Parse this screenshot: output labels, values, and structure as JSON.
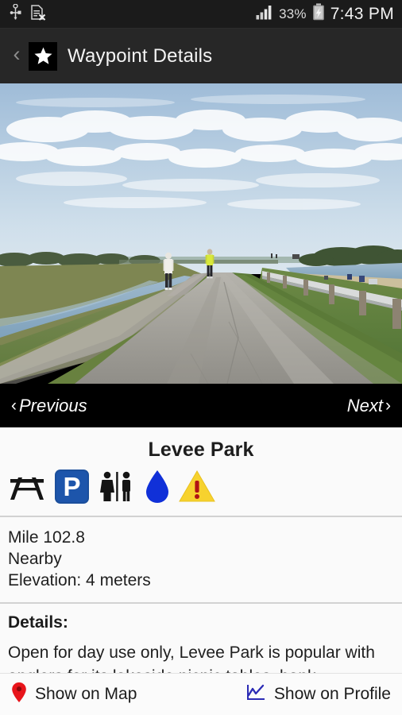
{
  "status_bar": {
    "usb_icon": "usb-icon",
    "no_sim_icon": "no-sim-card-icon",
    "signal_icon": "signal-bars-icon",
    "battery_percent": "33%",
    "battery_icon": "battery-charging-icon",
    "time": "7:43 PM"
  },
  "title_bar": {
    "back_icon": "‹",
    "star_icon": "star-icon",
    "title": "Waypoint Details"
  },
  "photo": {
    "alt": "levee-trail-photo",
    "description": "Paved levee trail with two walkers, canal at left and guardrail at right under a partly cloudy sky"
  },
  "photo_nav": {
    "previous_label": "Previous",
    "previous_chevron": "‹",
    "next_label": "Next",
    "next_chevron": "›"
  },
  "waypoint": {
    "name": "Levee Park",
    "amenities": [
      {
        "name": "picnic-table-icon",
        "label": "Picnic Table"
      },
      {
        "name": "parking-icon",
        "label": "Parking",
        "color": "#1b4f9c"
      },
      {
        "name": "restroom-icon",
        "label": "Restrooms"
      },
      {
        "name": "water-icon",
        "label": "Drinking Water",
        "color": "#1030d8"
      },
      {
        "name": "warning-icon",
        "label": "Warning",
        "color": "#f7d22e"
      }
    ],
    "mile": "Mile 102.8",
    "proximity": "Nearby",
    "elevation": "Elevation: 4 meters"
  },
  "details": {
    "label": "Details:",
    "text": "Open for day use only, Levee Park is popular with anglers for its lakeside picnic tables, bank"
  },
  "actions": {
    "map": {
      "icon": "map-pin-icon",
      "label": "Show on Map",
      "color": "#e8151b"
    },
    "profile": {
      "icon": "elevation-profile-icon",
      "label": "Show on Profile",
      "color": "#2b2bb5"
    }
  }
}
